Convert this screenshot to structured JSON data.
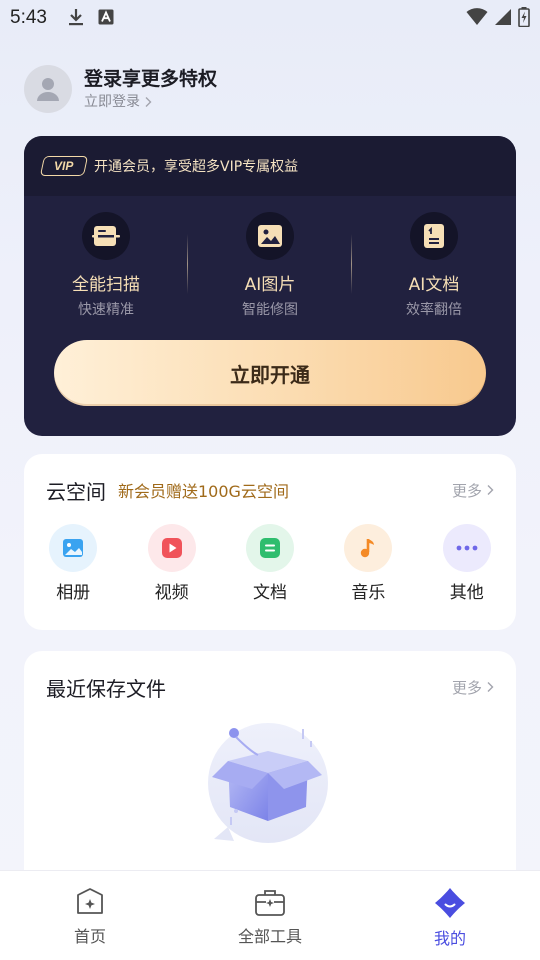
{
  "status_bar": {
    "time": "5:43",
    "icons": [
      "download-icon",
      "notification-a-icon",
      "wifi-icon",
      "signal-icon",
      "battery-charging-icon"
    ]
  },
  "profile": {
    "title": "登录享更多特权",
    "login_link": "立即登录"
  },
  "vip_card": {
    "badge": "VIP",
    "promo": "开通会员，享受超多VIP专属权益",
    "features": [
      {
        "title": "全能扫描",
        "subtitle": "快速精准",
        "icon": "scan-icon"
      },
      {
        "title": "AI图片",
        "subtitle": "智能修图",
        "icon": "image-icon"
      },
      {
        "title": "AI文档",
        "subtitle": "效率翻倍",
        "icon": "document-icon"
      }
    ],
    "open_button": "立即开通",
    "colors": {
      "background": "#21213f",
      "accent_gold": "#f6dfb6"
    }
  },
  "cloud": {
    "title": "云空间",
    "promo": "新会员赠送100G云空间",
    "more": "更多",
    "items": [
      {
        "label": "相册",
        "icon": "album-icon",
        "color": "#3aa3f0",
        "bg": "#e6f3fd"
      },
      {
        "label": "视频",
        "icon": "video-icon",
        "color": "#f0535a",
        "bg": "#fde8ea"
      },
      {
        "label": "文档",
        "icon": "document-icon",
        "color": "#2fbd6e",
        "bg": "#e3f6ea"
      },
      {
        "label": "音乐",
        "icon": "music-icon",
        "color": "#f48a26",
        "bg": "#fdeedd"
      },
      {
        "label": "其他",
        "icon": "more-dots-icon",
        "color": "#6f68e8",
        "bg": "#eceafd"
      }
    ]
  },
  "recent": {
    "title": "最近保存文件",
    "more": "更多"
  },
  "bottom_nav": {
    "items": [
      {
        "label": "首页",
        "icon": "home-icon"
      },
      {
        "label": "全部工具",
        "icon": "toolbox-icon"
      },
      {
        "label": "我的",
        "icon": "profile-icon",
        "active": true
      }
    ],
    "active_color": "#4a4de0"
  }
}
